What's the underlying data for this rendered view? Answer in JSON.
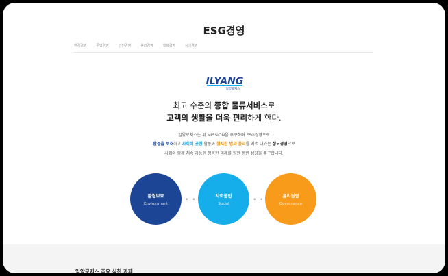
{
  "page": {
    "title": "ESG경영"
  },
  "tabs": [
    "환경경영",
    "준법경영",
    "안전경영",
    "윤리경영",
    "행복경영",
    "상생경영"
  ],
  "logo": {
    "text": "ILYANG",
    "subtext": "일양로지스"
  },
  "headline": {
    "line1_prefix": "최고 수준의 ",
    "line1_bold": "종합 물류서비스",
    "line1_suffix": "로",
    "line2_bold1": "고객의 생활을 더욱 편리",
    "line2_suffix": "하게 한다."
  },
  "paragraph": {
    "line1": "일양로지스는 위 MISSION을 추구하며 ESG경영으로",
    "line2_blue": "환경을 보호",
    "line2_a": "하고 ",
    "line2_cyan": "사회적 공헌",
    "line2_b": " 활동과 ",
    "line2_orange": "철저한 법과 윤리",
    "line2_c": "를 지켜 나가는 ",
    "line2_dark": "정도경영",
    "line2_d": "으로",
    "line3": "사회와 함께 지속 가능한 행복한 미래를 향한 동반 성장을 추구합니다."
  },
  "circles": [
    {
      "ko": "환경보호",
      "en": "Environment"
    },
    {
      "ko": "사회공헌",
      "en": "Social"
    },
    {
      "ko": "윤리경영",
      "en": "Governance"
    }
  ],
  "colors": {
    "environment": "#1d4595",
    "social": "#16aeea",
    "governance": "#f89a1a"
  },
  "dots": "• • •",
  "footer": {
    "title": "일양로지스 주요 실천 과제"
  }
}
